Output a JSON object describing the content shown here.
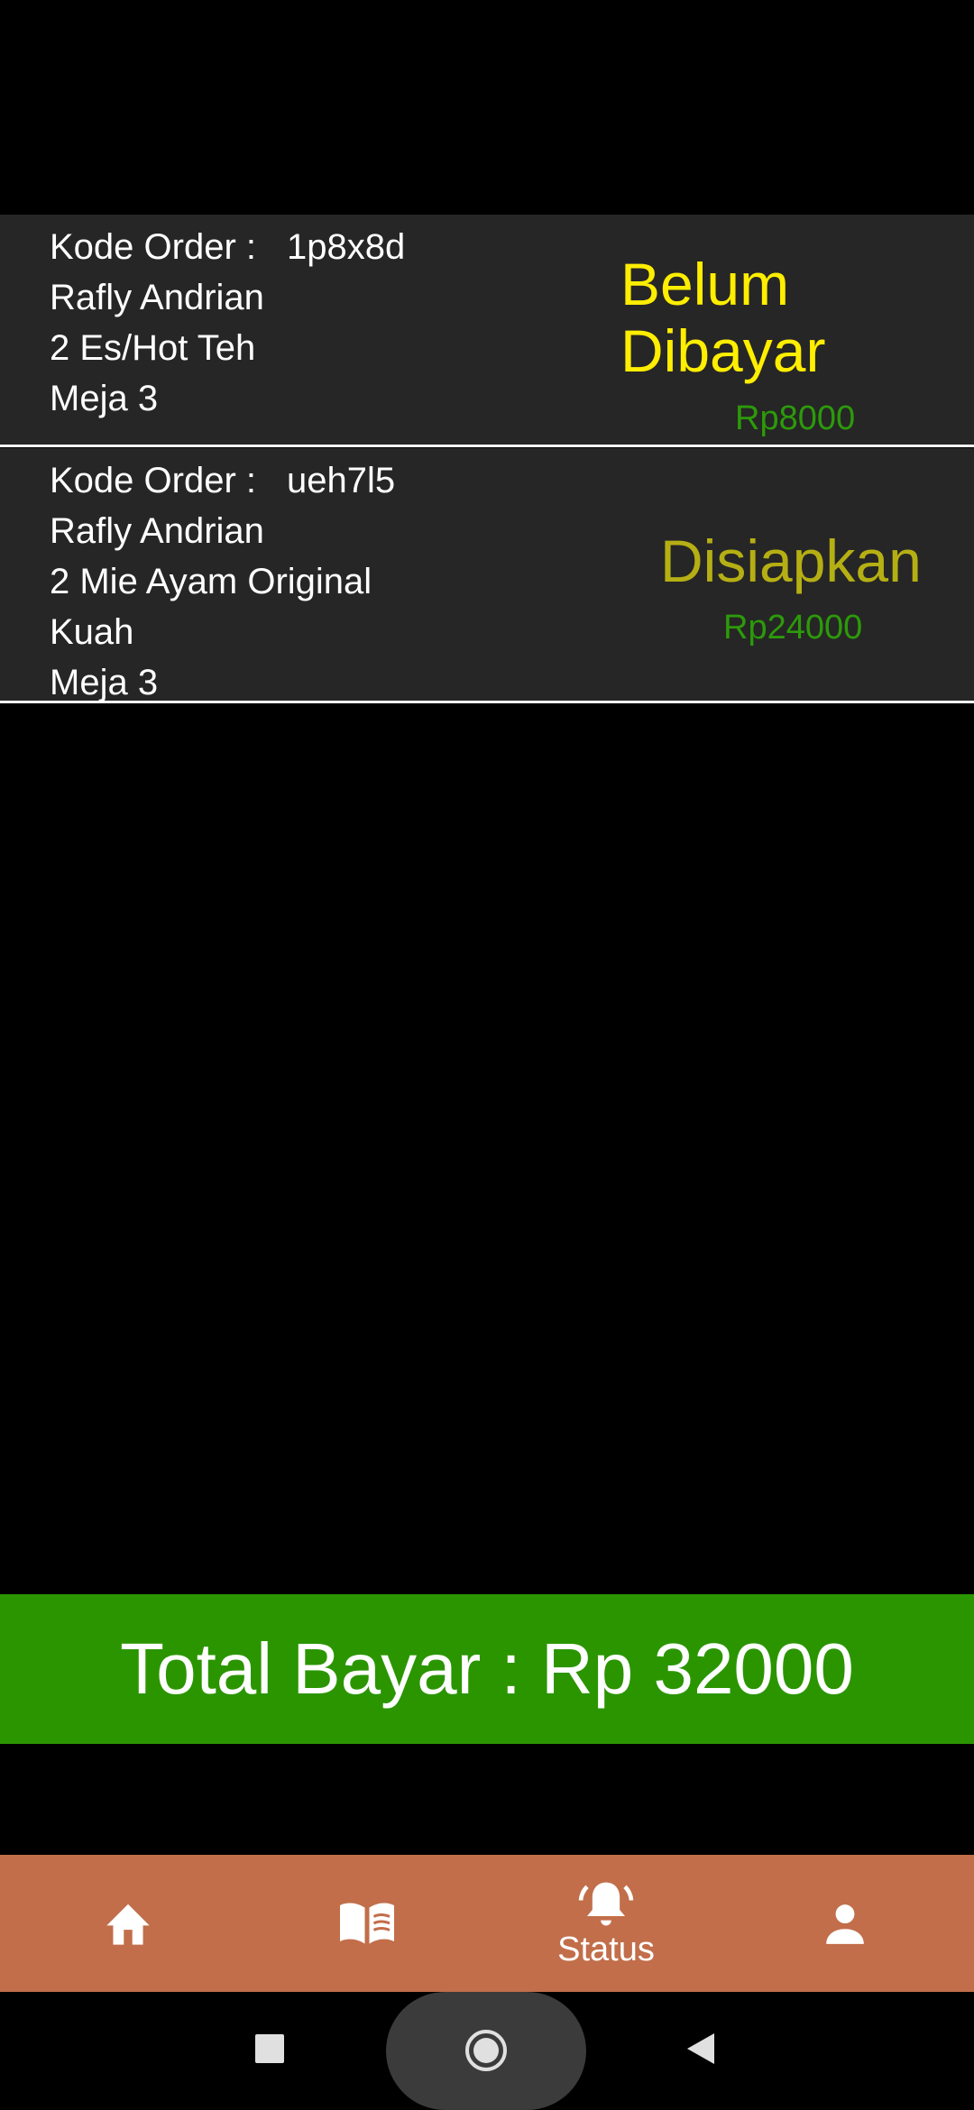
{
  "orders": [
    {
      "code_label": "Kode Order :",
      "code": "1p8x8d",
      "customer": "Rafly Andrian",
      "items": "2 Es/Hot Teh",
      "table": "Meja 3",
      "status": "Belum Dibayar",
      "status_color": "#ffee00",
      "price": "Rp8000"
    },
    {
      "code_label": "Kode Order :",
      "code": "ueh7l5",
      "customer": "Rafly Andrian",
      "items": "2 Mie Ayam Original Kuah",
      "table": "Meja 3",
      "status": "Disiapkan",
      "status_color": "#b5af14",
      "price": "Rp24000"
    }
  ],
  "total": {
    "label": "Total Bayar : Rp 32000"
  },
  "bottom_nav": {
    "items": [
      {
        "icon": "home-icon",
        "label": ""
      },
      {
        "icon": "menu-book-icon",
        "label": ""
      },
      {
        "icon": "notification-bell-icon",
        "label": "Status",
        "active": true
      },
      {
        "icon": "person-icon",
        "label": ""
      }
    ]
  },
  "colors": {
    "background": "#000000",
    "card": "#262626",
    "price": "#2c9a0a",
    "total_bar": "#2b9500",
    "bottom_nav": "#c26e4a"
  }
}
